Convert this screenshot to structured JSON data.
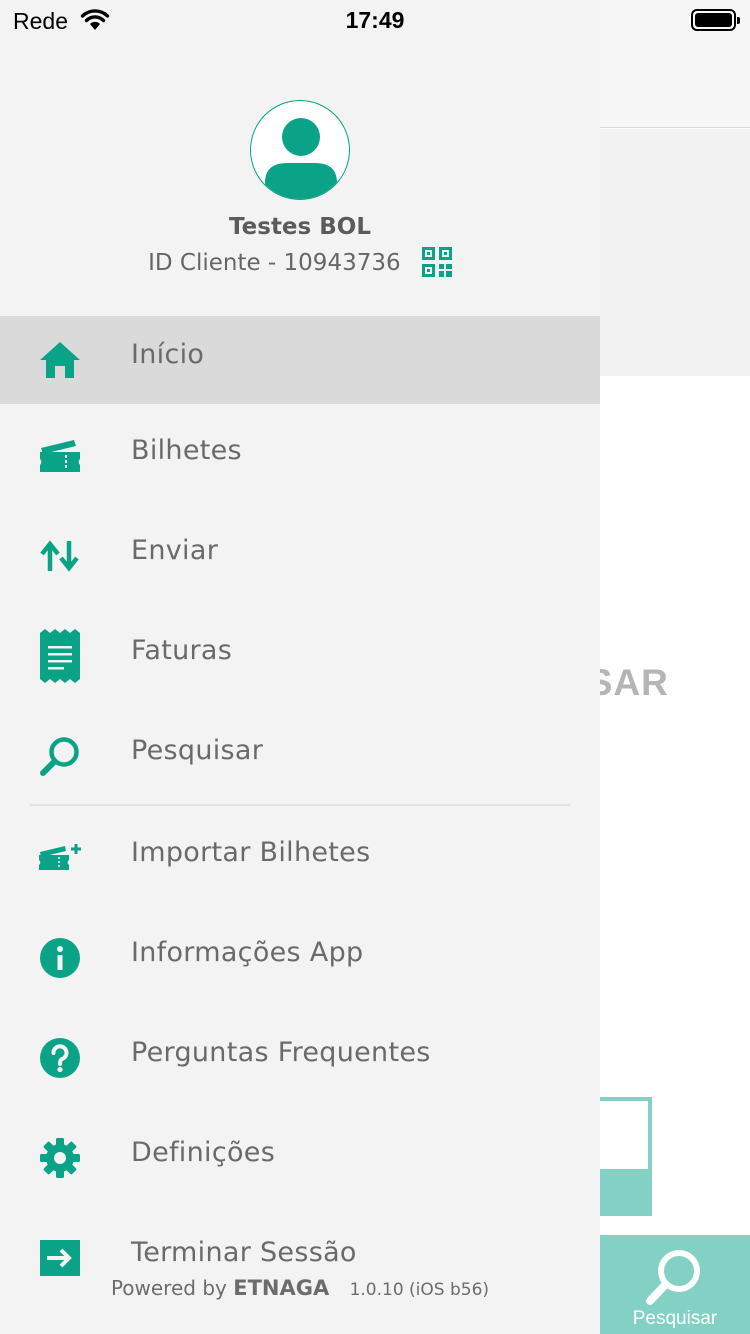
{
  "status_bar": {
    "carrier": "Rede",
    "time": "17:49"
  },
  "background": {
    "partial_text": "USAR",
    "tab_label": "Pesquisar"
  },
  "profile": {
    "name": "Testes BOL",
    "client_id": "ID Cliente - 10943736"
  },
  "menu": {
    "inicio": "Início",
    "bilhetes": "Bilhetes",
    "enviar": "Enviar",
    "faturas": "Faturas",
    "pesquisar": "Pesquisar",
    "importar": "Importar Bilhetes",
    "info": "Informações App",
    "faq": "Perguntas Frequentes",
    "definicoes": "Definições",
    "terminar": "Terminar Sessão"
  },
  "footer": {
    "powered_by": "Powered by",
    "brand": "ETNAGA",
    "version": "1.0.10 (iOS b56)"
  },
  "colors": {
    "accent": "#0aa387",
    "accent_light": "#83d1c4",
    "drawer_bg": "#f2f3f2",
    "active_bg": "#dadada"
  }
}
